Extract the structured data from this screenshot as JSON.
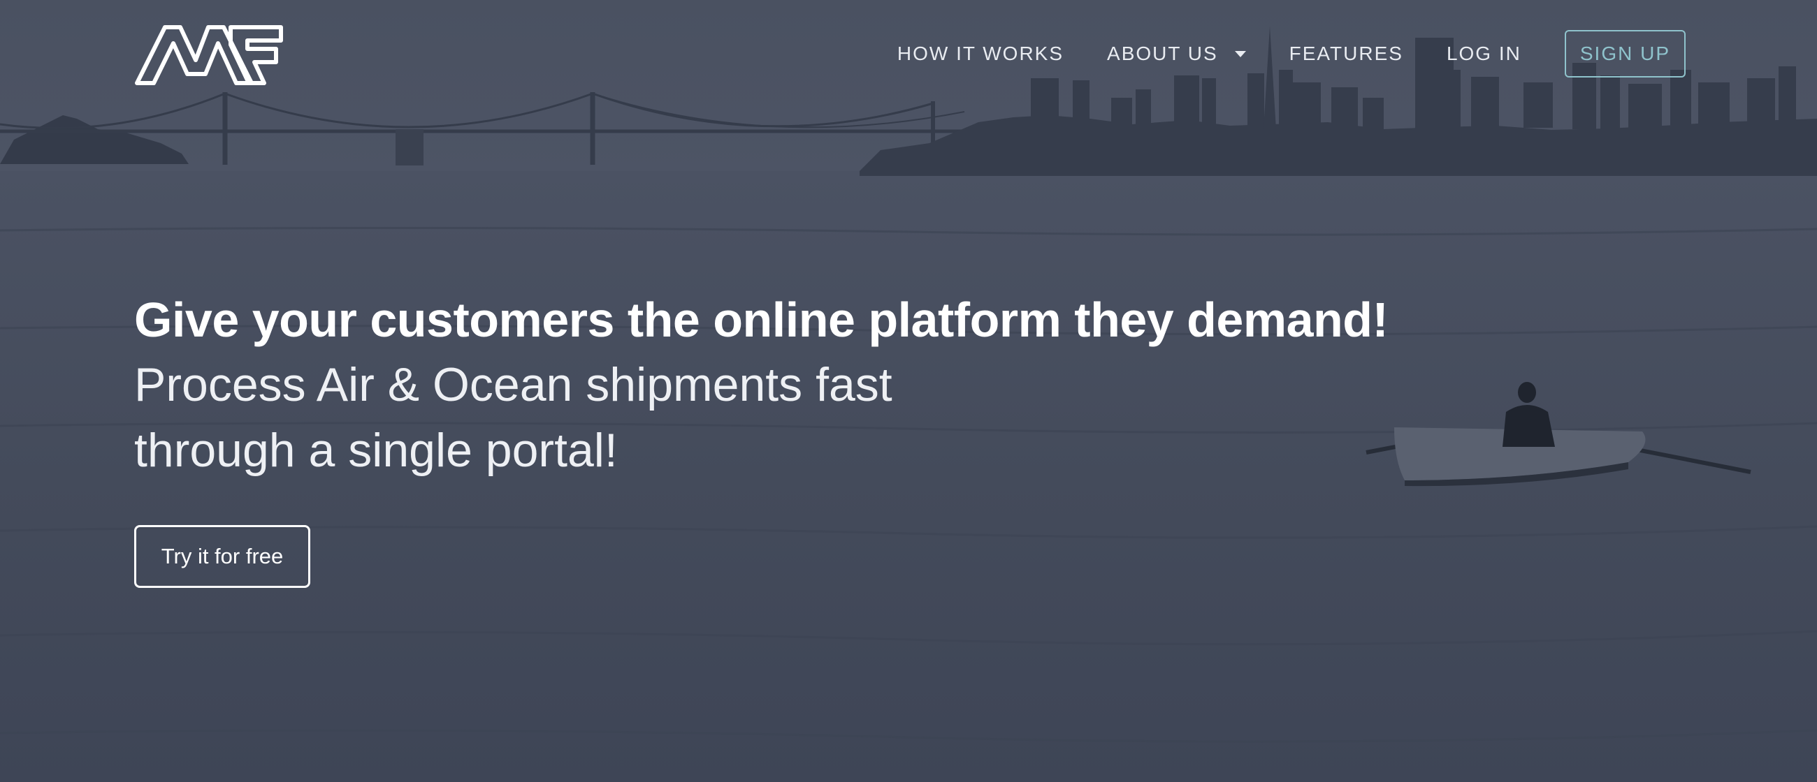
{
  "brand": {
    "logo_text": "MF"
  },
  "nav": {
    "items": [
      {
        "label": "HOW IT WORKS"
      },
      {
        "label": "ABOUT US",
        "has_dropdown": true
      },
      {
        "label": "FEATURES"
      },
      {
        "label": "LOG IN"
      }
    ],
    "signup_label": "SIGN UP"
  },
  "hero": {
    "headline": "Give your customers the online platform they demand!",
    "subline_1": "Process Air & Ocean shipments fast",
    "subline_2": "through a single portal!",
    "cta_label": "Try it for free"
  },
  "colors": {
    "overlay": "#454c5c",
    "text": "#ffffff",
    "signup_accent": "#8fc3cc"
  }
}
